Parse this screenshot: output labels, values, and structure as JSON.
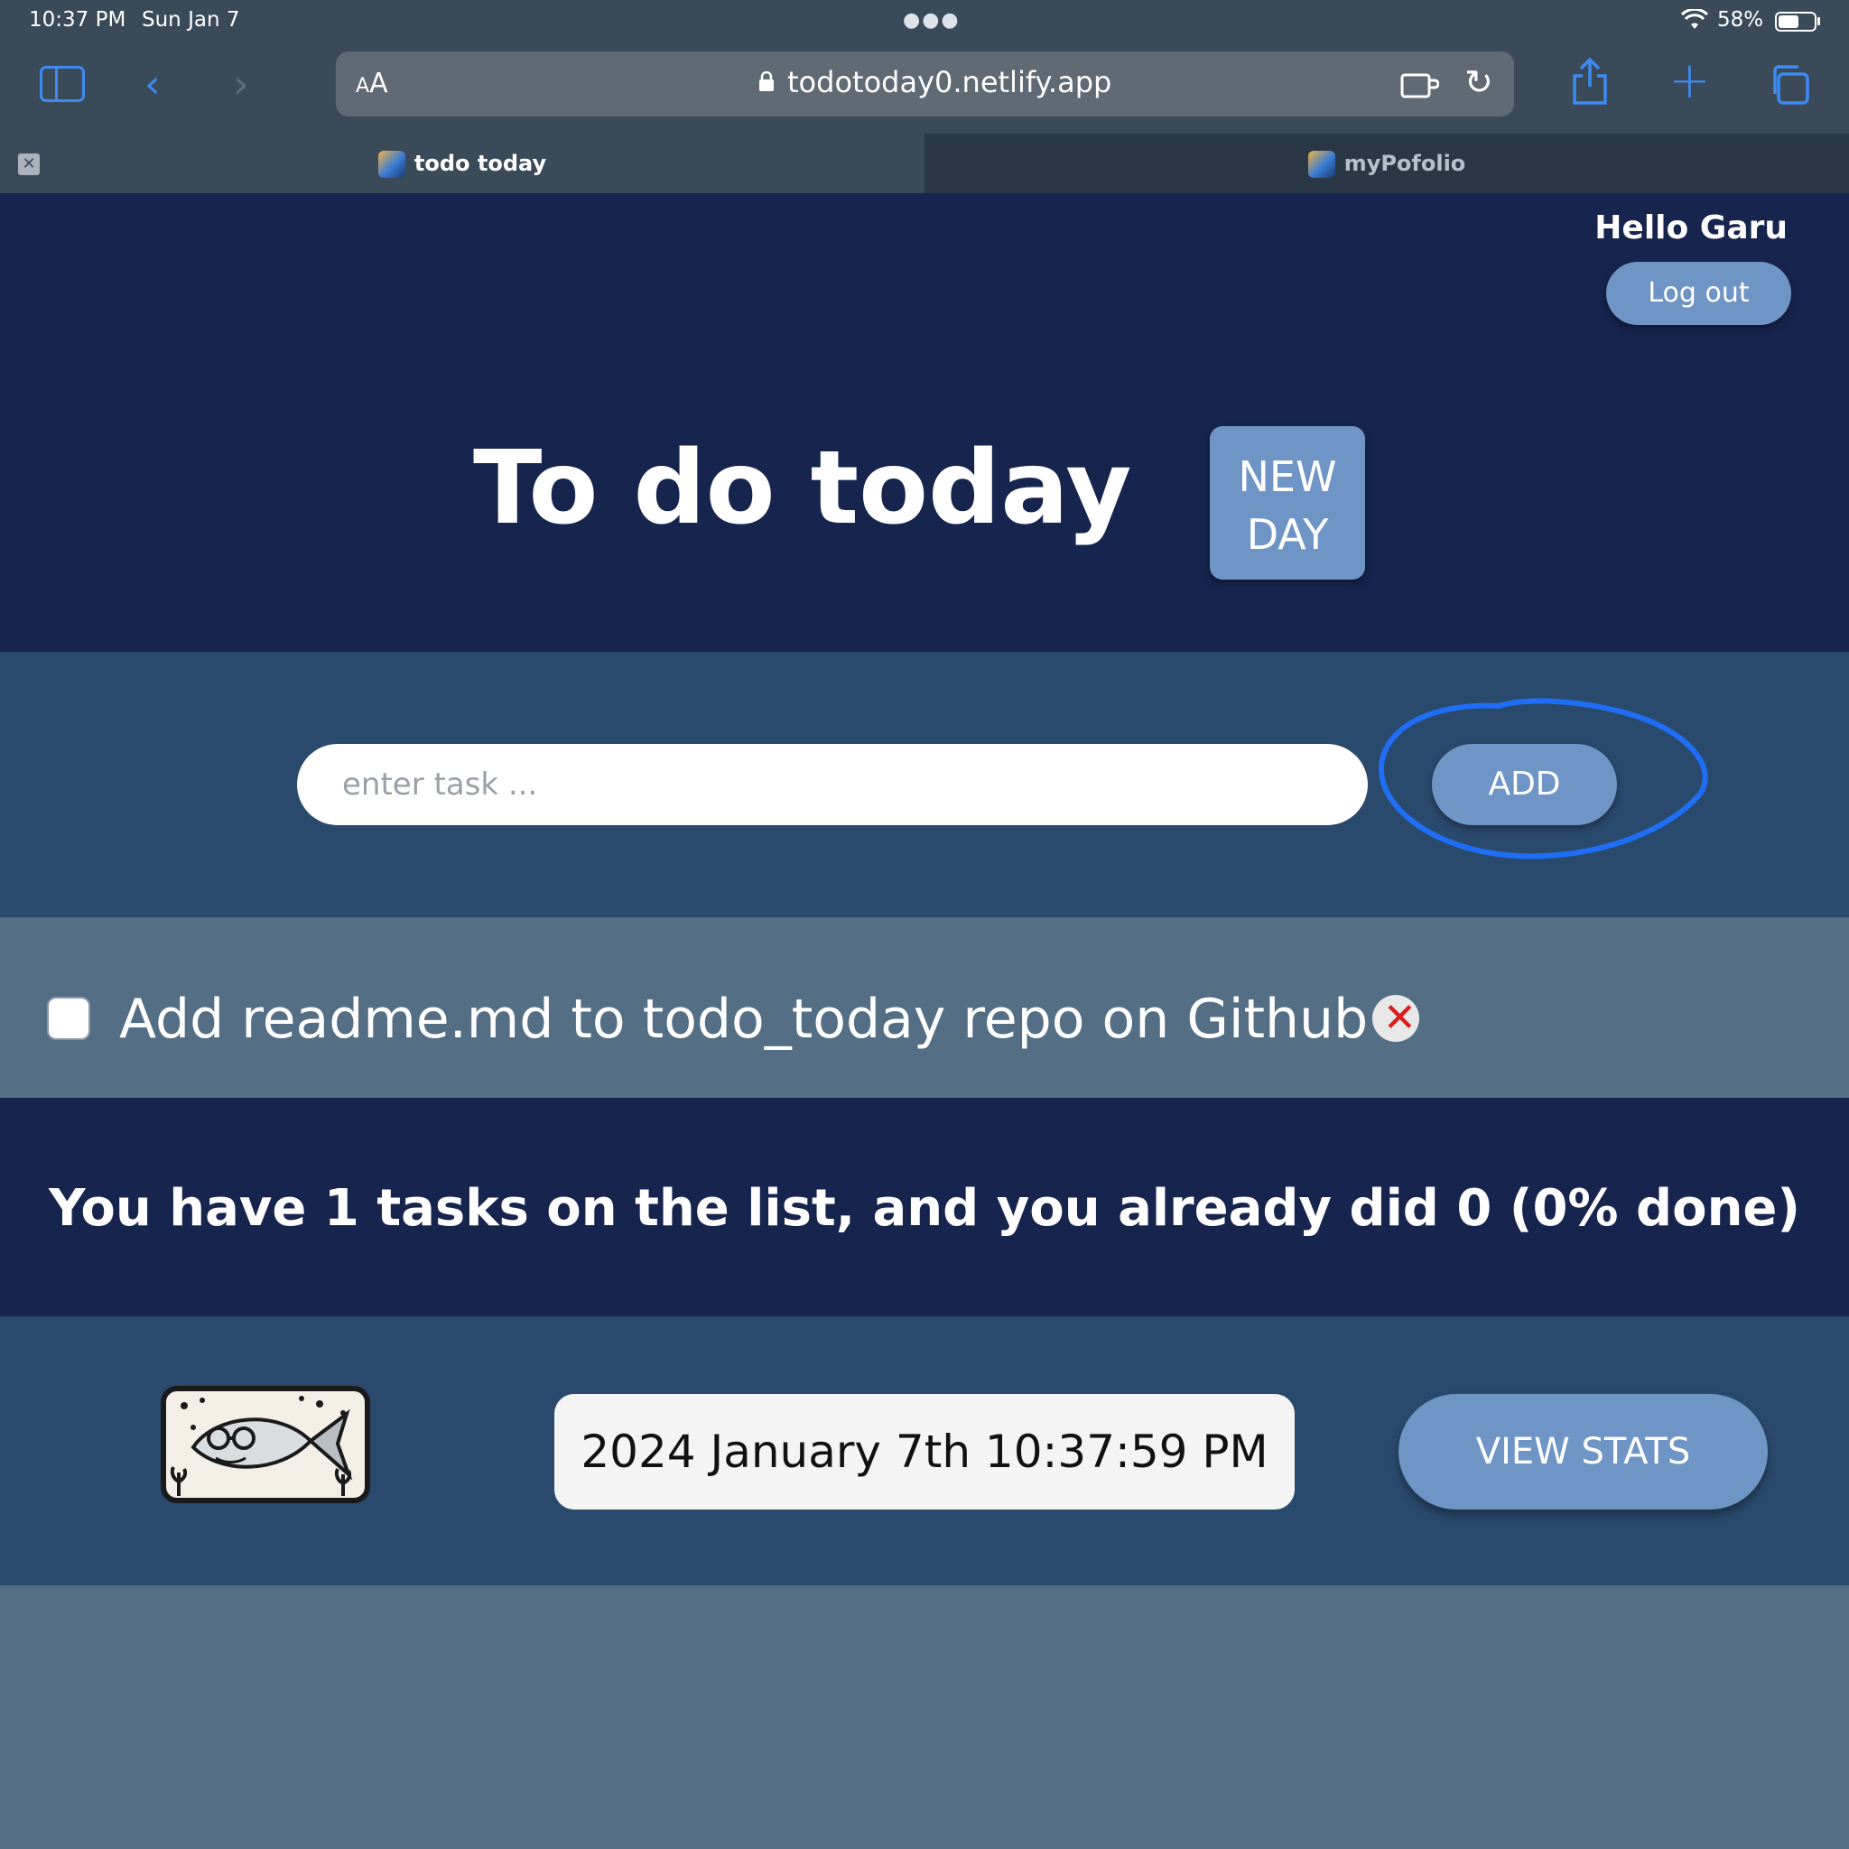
{
  "status_bar": {
    "time": "10:37 PM",
    "date": "Sun Jan 7",
    "battery_percent": "58%",
    "battery_level": 0.58
  },
  "browser": {
    "text_size_label": "AA",
    "url": "todotoday0.netlify.app",
    "icons": [
      "sidebar-icon",
      "back-icon",
      "forward-icon",
      "lock-icon",
      "extension-icon",
      "reload-icon",
      "share-icon",
      "plus-icon",
      "tabs-icon"
    ],
    "tabs": [
      {
        "label": "todo today",
        "active": true
      },
      {
        "label": "myPofolio",
        "active": false
      }
    ],
    "tab_close_glyph": "✕"
  },
  "header": {
    "greeting": "Hello Garu",
    "logout_label": "Log out",
    "title": "To do today",
    "new_day_line1": "NEW",
    "new_day_line2": "DAY"
  },
  "task_entry": {
    "placeholder": "enter task ...",
    "value": "",
    "add_label": "ADD"
  },
  "tasks": [
    {
      "text": "Add readme.md to todo_today repo on Github",
      "done": false
    }
  ],
  "summary": {
    "text": "You have 1 tasks on the list, and you already did 0 (0% done)"
  },
  "footer": {
    "datetime": "2024 January 7th 10:37:59 PM",
    "view_stats_label": "VIEW STATS",
    "logo": "fish-with-glasses-logo"
  },
  "colors": {
    "header_bg": "#17244d",
    "section_bg": "#2a4a6d",
    "list_bg": "#546e85",
    "button": "#6f95c6",
    "annotation": "#1e6ff5",
    "delete_x": "#e01b1b"
  }
}
